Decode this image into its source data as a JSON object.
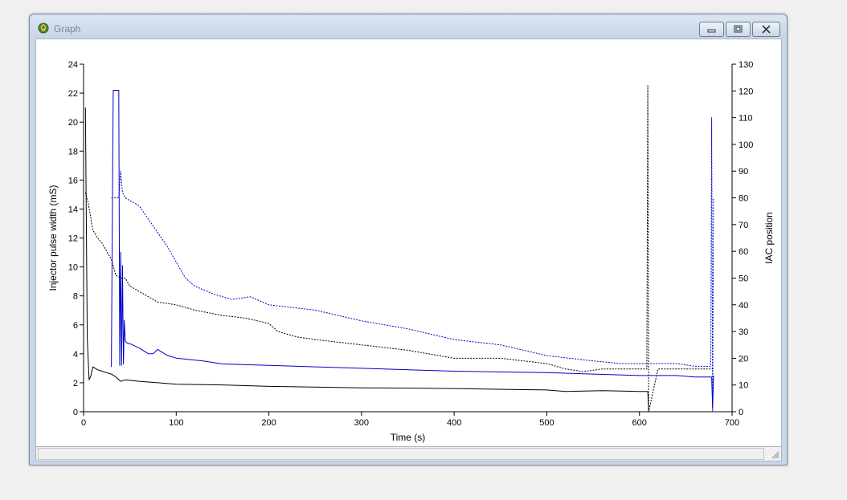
{
  "window": {
    "title": "Graph"
  },
  "colors": {
    "primary_series": "#000000",
    "secondary_series": "#0000cc"
  },
  "chart_data": {
    "type": "line",
    "title": "",
    "xlabel": "Time (s)",
    "ylabel": "Injector pulse width (mS)",
    "y2label": "IAC position",
    "xlim": [
      0,
      700
    ],
    "ylim": [
      0,
      24
    ],
    "y2lim": [
      0,
      130
    ],
    "xticks": [
      0,
      100,
      200,
      300,
      400,
      500,
      600,
      700
    ],
    "yticks": [
      0,
      2,
      4,
      6,
      8,
      10,
      12,
      14,
      16,
      18,
      20,
      22,
      24
    ],
    "y2ticks": [
      0,
      10,
      20,
      30,
      40,
      50,
      60,
      70,
      80,
      90,
      100,
      110,
      120,
      130
    ],
    "grid": false,
    "series": [
      {
        "axis": "left",
        "color": "#000000",
        "style": "solid",
        "x": [
          2,
          4,
          6,
          8,
          10,
          15,
          20,
          25,
          30,
          35,
          40,
          45,
          60,
          80,
          100,
          150,
          200,
          300,
          400,
          500,
          520,
          560,
          600,
          608,
          609,
          610
        ],
        "y": [
          21.0,
          5.0,
          2.2,
          2.5,
          3.1,
          2.9,
          2.8,
          2.7,
          2.6,
          2.4,
          2.1,
          2.2,
          2.1,
          2.0,
          1.9,
          1.85,
          1.75,
          1.65,
          1.6,
          1.5,
          1.4,
          1.45,
          1.4,
          1.4,
          1.4,
          0
        ]
      },
      {
        "axis": "left",
        "color": "#0000cc",
        "style": "solid",
        "x": [
          30,
          31,
          32,
          33,
          34,
          36,
          38,
          39,
          40,
          41,
          42,
          43,
          44,
          45,
          46,
          48,
          50,
          60,
          70,
          75,
          80,
          90,
          100,
          130,
          150,
          200,
          300,
          400,
          500,
          550,
          600,
          620,
          640,
          660,
          678,
          679,
          680
        ],
        "y": [
          3.1,
          12.7,
          22.2,
          22.2,
          22.2,
          22.2,
          22.2,
          3.2,
          11.0,
          3.2,
          10.1,
          3.3,
          6.3,
          4.9,
          4.8,
          4.7,
          4.7,
          4.4,
          4.0,
          4.0,
          4.3,
          3.9,
          3.7,
          3.5,
          3.3,
          3.2,
          3.0,
          2.8,
          2.7,
          2.6,
          2.5,
          2.5,
          2.5,
          2.4,
          2.4,
          0.2,
          2.5
        ]
      },
      {
        "axis": "right",
        "color": "#000000",
        "style": "dashed",
        "x": [
          2,
          5,
          10,
          15,
          20,
          25,
          30,
          35,
          40,
          45,
          50,
          60,
          70,
          80,
          100,
          120,
          150,
          175,
          200,
          210,
          230,
          250,
          300,
          350,
          400,
          450,
          500,
          520,
          540,
          560,
          600,
          608,
          609,
          610,
          620,
          650,
          680
        ],
        "y": [
          82,
          78,
          68,
          65,
          63,
          60,
          57,
          51,
          50,
          50,
          47,
          45,
          43,
          41,
          40,
          38,
          36,
          35,
          33,
          30,
          28,
          27,
          25,
          23,
          20,
          20,
          18,
          16,
          15,
          16,
          16,
          16,
          122,
          0,
          16,
          16,
          16
        ]
      },
      {
        "axis": "right",
        "color": "#0000cc",
        "style": "dashed",
        "x": [
          30,
          35,
          38,
          40,
          42,
          45,
          50,
          60,
          70,
          80,
          90,
          100,
          110,
          120,
          140,
          160,
          180,
          200,
          250,
          300,
          350,
          400,
          450,
          500,
          550,
          580,
          600,
          640,
          660,
          677,
          678,
          679,
          680
        ],
        "y": [
          80,
          80,
          80,
          90,
          82,
          80,
          79,
          77,
          72,
          67,
          62,
          56,
          50,
          47,
          44,
          42,
          43,
          40,
          38,
          34,
          31,
          27,
          25,
          21,
          19,
          18,
          18,
          18,
          17,
          17,
          110,
          0,
          80
        ]
      }
    ]
  }
}
